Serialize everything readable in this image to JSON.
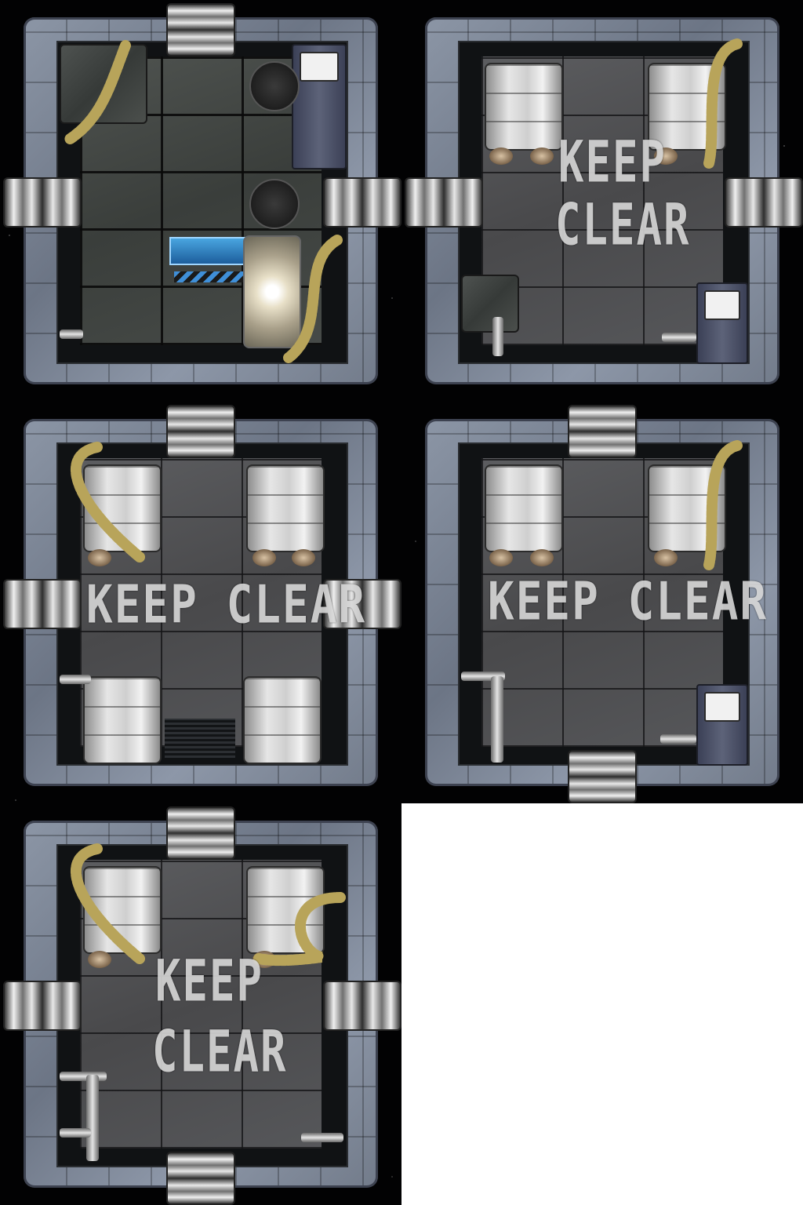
{
  "sheet": {
    "type": "map-tile-sheet",
    "tile_count": 5,
    "blank_slot": true
  },
  "tiles": [
    {
      "id": "tile-1",
      "room": "reactor-control",
      "floor_text": "",
      "doors": [
        "top",
        "left",
        "right"
      ],
      "features": [
        "storage-crate",
        "hose",
        "sink-console",
        "floor-hatch",
        "floor-hatch",
        "computer-screen",
        "reactor-core",
        "pipe-elbow"
      ]
    },
    {
      "id": "tile-2",
      "room": "tank-bay",
      "floor_text": "KEEP CLEAR",
      "floor_lines": [
        "KEEP",
        "CLEAR"
      ],
      "doors": [
        "left",
        "right"
      ],
      "features": [
        "tank",
        "tank",
        "hose",
        "machine",
        "sink-console",
        "pipe-elbow"
      ]
    },
    {
      "id": "tile-3",
      "room": "tank-bay",
      "floor_text": "KEEP  CLEAR",
      "floor_lines": [
        "KEEP  CLEAR"
      ],
      "doors": [
        "top",
        "left",
        "right"
      ],
      "features": [
        "tank",
        "tank",
        "tank",
        "tank",
        "hose",
        "floor-grates",
        "pipe"
      ]
    },
    {
      "id": "tile-4",
      "room": "tank-bay",
      "floor_text": "KEEP  CLEAR",
      "floor_lines": [
        "KEEP  CLEAR"
      ],
      "doors": [
        "top",
        "bottom"
      ],
      "features": [
        "tank",
        "tank",
        "hose",
        "pipe-tee",
        "sink-console",
        "pipe-elbow"
      ]
    },
    {
      "id": "tile-5",
      "room": "tank-bay",
      "floor_text": "KEEP CLEAR",
      "floor_lines": [
        "KEEP",
        "CLEAR"
      ],
      "doors": [
        "top",
        "bottom",
        "left",
        "right"
      ],
      "features": [
        "tank",
        "tank",
        "hose",
        "hose",
        "pipe-tee",
        "pipe-elbow"
      ]
    }
  ],
  "colors": {
    "hull": "#7a8393",
    "floor": "#4f5052",
    "stencil": "#d7d7d7",
    "hose": "#b8a45a",
    "screen": "#3a92d6"
  }
}
